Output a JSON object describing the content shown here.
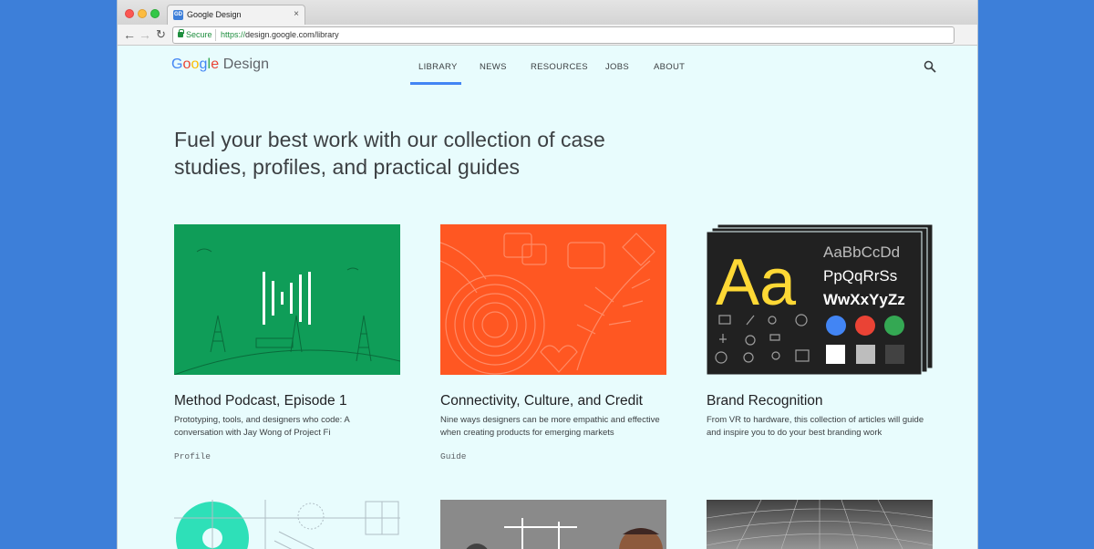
{
  "browser": {
    "tab_title": "Google Design",
    "tab_favicon": "GD",
    "close_glyph": "×",
    "secure_label": "Secure",
    "url_scheme": "https://",
    "url_rest": "design.google.com/library"
  },
  "site": {
    "logo_letters": [
      "G",
      "o",
      "o",
      "g",
      "l",
      "e"
    ],
    "logo_design": " Design",
    "nav": [
      {
        "label": "LIBRARY",
        "active": true
      },
      {
        "label": "NEWS",
        "active": false
      },
      {
        "label": "RESOURCES",
        "active": false
      },
      {
        "label": "JOBS",
        "active": false
      },
      {
        "label": "ABOUT",
        "active": false
      }
    ]
  },
  "hero": {
    "line1": "Fuel your best work with our collection of case",
    "line2": "studies, profiles, and practical guides"
  },
  "cards": [
    {
      "title": "Method Podcast, Episode 1",
      "description": "Prototyping, tools, and designers who code: A conversation with Jay Wong of Project Fi",
      "tag": "Profile",
      "image_color": "#0f9d58"
    },
    {
      "title": "Connectivity, Culture, and Credit",
      "description": "Nine ways designers can be more empathic and effective when creating products for emerging markets",
      "tag": "Guide",
      "image_color": "#ff5722"
    },
    {
      "title": "Brand Recognition",
      "description": "From VR to hardware, this collection of articles will guide and inspire you to do your best branding work",
      "tag": "",
      "image_color": "#212121",
      "type_sample": {
        "big": "Aa",
        "row1": "AaBbCcDd",
        "row2": "PpQqRrSs",
        "row3": "WwXxYyZz"
      }
    }
  ],
  "colors": {
    "page_bg": "#3d7fd9",
    "content_bg": "#e8fcfd",
    "accent": "#4285f4",
    "swatches": [
      "#4285f4",
      "#ea4335",
      "#34a853",
      "#ffffff",
      "#bdbdbd",
      "#424242"
    ]
  }
}
